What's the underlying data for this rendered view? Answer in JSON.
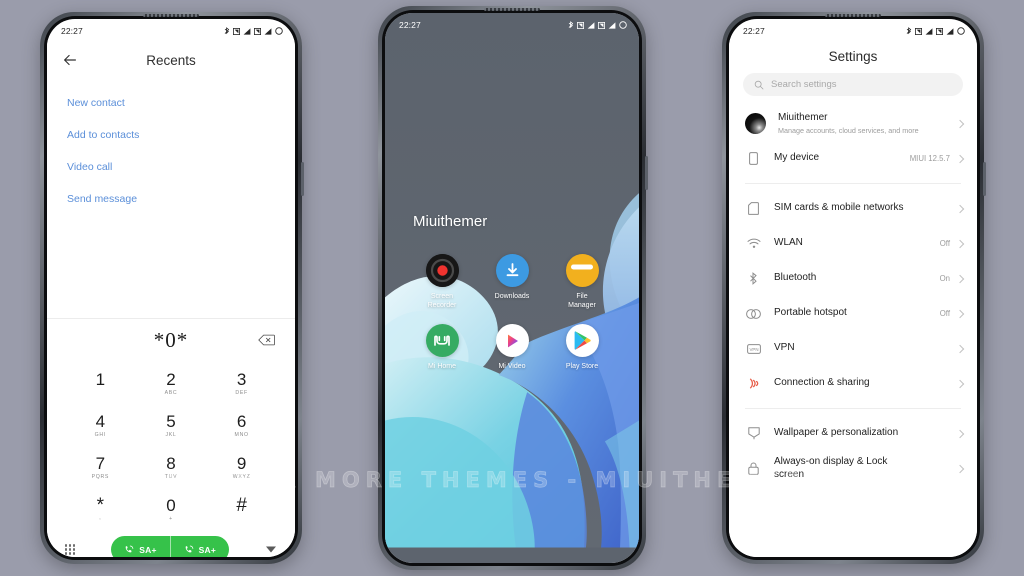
{
  "background_color": "#9a9cab",
  "watermark": "VISIT FOR MORE THEMES - MIUITHEMER.COM",
  "status_bar": {
    "time": "22:27"
  },
  "phone_left": {
    "screen_name": "dialer-recents",
    "header": {
      "title": "Recents",
      "back_icon": "arrow-left-icon"
    },
    "actions": [
      {
        "label": "New contact"
      },
      {
        "label": "Add to contacts"
      },
      {
        "label": "Video call"
      },
      {
        "label": "Send message"
      }
    ],
    "dial_input": {
      "value": "*0*",
      "backspace_icon": "backspace-icon"
    },
    "keypad": [
      {
        "digit": "1",
        "letters": ""
      },
      {
        "digit": "2",
        "letters": "ABC"
      },
      {
        "digit": "3",
        "letters": "DEF"
      },
      {
        "digit": "4",
        "letters": "GHI"
      },
      {
        "digit": "5",
        "letters": "JKL"
      },
      {
        "digit": "6",
        "letters": "MNO"
      },
      {
        "digit": "7",
        "letters": "PQRS"
      },
      {
        "digit": "8",
        "letters": "TUV"
      },
      {
        "digit": "9",
        "letters": "WXYZ"
      },
      {
        "digit": "*",
        "letters": ","
      },
      {
        "digit": "0",
        "letters": "+"
      },
      {
        "digit": "#",
        "letters": ""
      }
    ],
    "call_bar": {
      "keypad_toggle_icon": "grid-dots-icon",
      "call_sim1_label": "SA+",
      "call_sim2_label": "SA+",
      "expand_icon": "chevron-down-icon",
      "accent_color": "#36c24a"
    }
  },
  "phone_center": {
    "screen_name": "home-screen",
    "clock_widget": "Miuithemer",
    "apps": [
      {
        "label": "Screen\nRecorder",
        "icon": "screen-recorder-icon"
      },
      {
        "label": "Downloads",
        "icon": "download-icon"
      },
      {
        "label": "File\nManager",
        "icon": "file-manager-icon"
      },
      {
        "label": "Mi Home",
        "icon": "mi-home-icon"
      },
      {
        "label": "Mi Video",
        "icon": "mi-video-icon"
      },
      {
        "label": "Play Store",
        "icon": "play-store-icon"
      }
    ]
  },
  "phone_right": {
    "screen_name": "settings",
    "title": "Settings",
    "search": {
      "placeholder": "Search settings",
      "icon": "search-icon"
    },
    "account": {
      "name": "Miuithemer",
      "subtitle": "Manage accounts, cloud services, and more",
      "avatar": "user-avatar"
    },
    "groups": [
      {
        "rows": [
          {
            "label": "My device",
            "value": "MIUI 12.5.7",
            "icon": "phone-icon"
          }
        ]
      },
      {
        "rows": [
          {
            "label": "SIM cards & mobile networks",
            "value": "",
            "icon": "sim-card-icon"
          },
          {
            "label": "WLAN",
            "value": "Off",
            "icon": "wifi-icon"
          },
          {
            "label": "Bluetooth",
            "value": "On",
            "icon": "bluetooth-icon"
          },
          {
            "label": "Portable hotspot",
            "value": "Off",
            "icon": "hotspot-icon"
          },
          {
            "label": "VPN",
            "value": "",
            "icon": "vpn-icon"
          },
          {
            "label": "Connection & sharing",
            "value": "",
            "icon": "connection-sharing-icon"
          }
        ]
      },
      {
        "rows": [
          {
            "label": "Wallpaper & personalization",
            "value": "",
            "icon": "wallpaper-icon"
          },
          {
            "label": "Always-on display & Lock screen",
            "value": "",
            "icon": "lock-icon"
          }
        ]
      }
    ]
  }
}
